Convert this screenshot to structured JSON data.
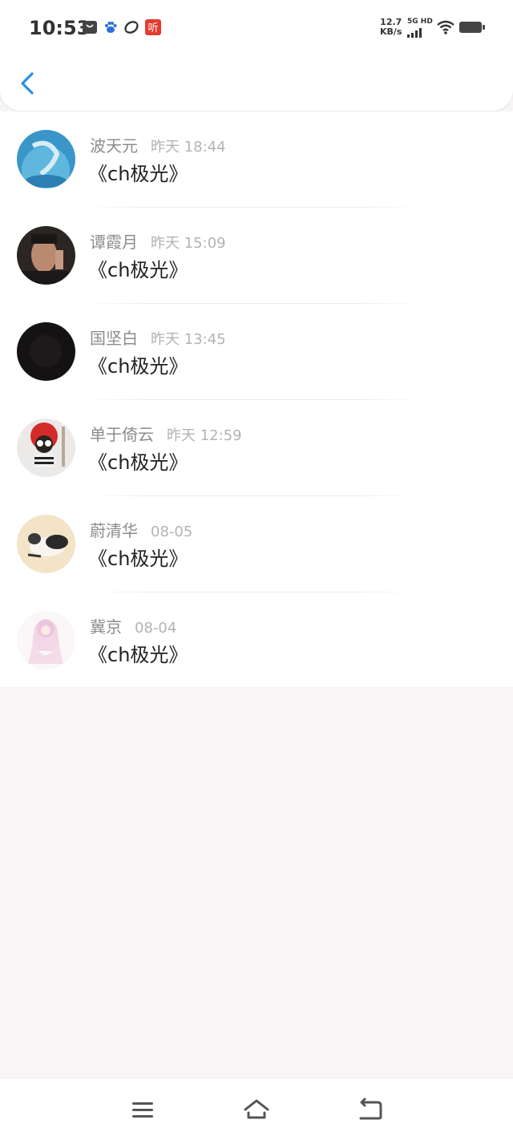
{
  "status_bar": {
    "time": "10:53",
    "net_speed_value": "12.7",
    "net_speed_unit": "KB/s",
    "network_label": "5G HD",
    "icons": [
      "message-icon",
      "baidu-paw-icon",
      "link-app-icon",
      "listen-app-icon",
      "signal-icon",
      "wifi-icon",
      "battery-icon"
    ],
    "listen_icon_text": "听"
  },
  "header": {
    "back_icon": "chevron-left-icon",
    "accent_color": "#2b8fe6"
  },
  "messages": [
    {
      "name": "波天元",
      "date": "昨天 18:44",
      "title": "《ch极光》"
    },
    {
      "name": "谭霞月",
      "date": "昨天 15:09",
      "title": "《ch极光》"
    },
    {
      "name": "国坚白",
      "date": "昨天 13:45",
      "title": "《ch极光》"
    },
    {
      "name": "单于倚云",
      "date": "昨天 12:59",
      "title": "《ch极光》"
    },
    {
      "name": "蔚清华",
      "date": "08-05",
      "title": "《ch极光》"
    },
    {
      "name": "冀京",
      "date": "08-04",
      "title": "《ch极光》"
    }
  ],
  "nav_bar": {
    "icons": [
      "menu-icon",
      "home-icon",
      "back-icon"
    ]
  }
}
